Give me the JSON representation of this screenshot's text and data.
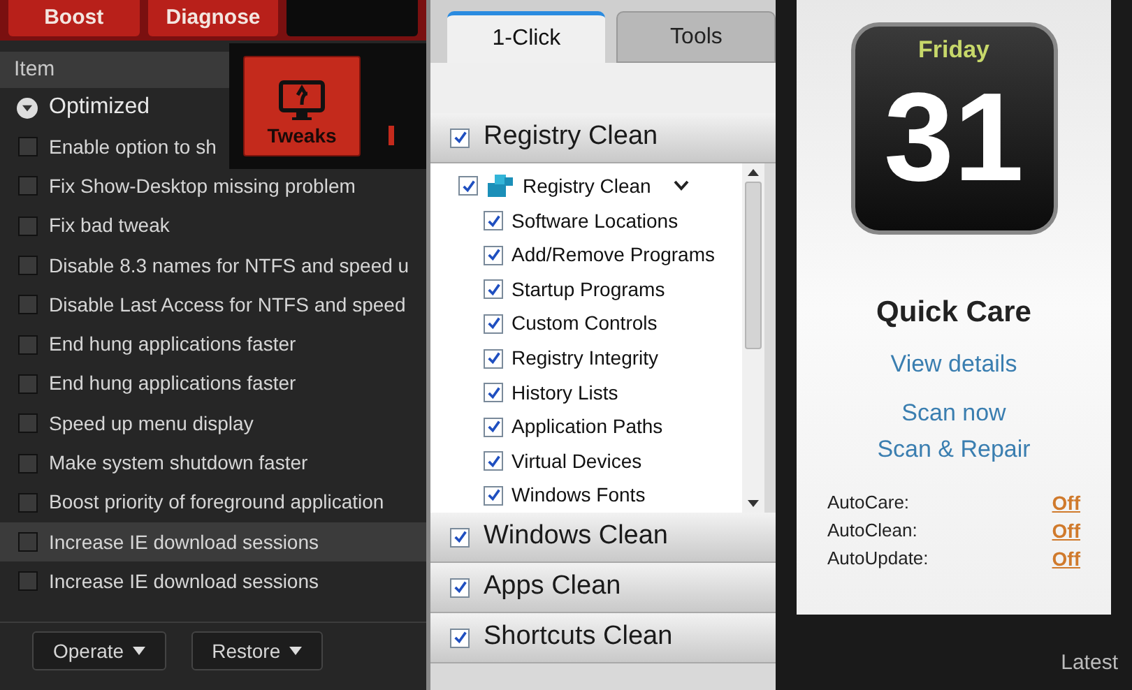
{
  "left_panel": {
    "tabs": [
      {
        "label": "Boost",
        "selected": false
      },
      {
        "label": "Diagnose",
        "selected": false
      },
      {
        "selected": true
      }
    ],
    "popup": {
      "label": "Tweaks"
    },
    "column_header": "Item",
    "group": {
      "label": "Optimized",
      "expanded": true
    },
    "items": [
      {
        "label": "Enable option to sh",
        "checked": false,
        "selected": false
      },
      {
        "label": "Fix Show-Desktop missing problem",
        "checked": false,
        "selected": false
      },
      {
        "label": "Fix bad tweak",
        "checked": false,
        "selected": false
      },
      {
        "label": "Disable 8.3 names for NTFS and speed u",
        "checked": false,
        "selected": false
      },
      {
        "label": "Disable Last Access for NTFS and speed",
        "checked": false,
        "selected": false
      },
      {
        "label": "End hung applications faster",
        "checked": false,
        "selected": false
      },
      {
        "label": "End hung applications faster",
        "checked": false,
        "selected": false
      },
      {
        "label": "Speed up menu display",
        "checked": false,
        "selected": false
      },
      {
        "label": "Make system shutdown faster",
        "checked": false,
        "selected": false
      },
      {
        "label": "Boost priority of foreground application",
        "checked": false,
        "selected": false
      },
      {
        "label": "Increase IE download sessions",
        "checked": false,
        "selected": true
      },
      {
        "label": "Increase IE download sessions",
        "checked": false,
        "selected": false
      }
    ],
    "buttons": [
      "Operate",
      "Restore"
    ]
  },
  "middle_panel": {
    "tabs": [
      {
        "label": "1-Click",
        "selected": true
      },
      {
        "label": "Tools",
        "selected": false
      }
    ],
    "sections": [
      {
        "label": "Registry Clean",
        "checked": true,
        "expanded": true,
        "tree": {
          "label": "Registry Clean",
          "checked": true,
          "children": [
            {
              "label": "Software Locations",
              "checked": true
            },
            {
              "label": "Add/Remove Programs",
              "checked": true
            },
            {
              "label": "Startup Programs",
              "checked": true
            },
            {
              "label": "Custom Controls",
              "checked": true
            },
            {
              "label": "Registry Integrity",
              "checked": true
            },
            {
              "label": "History Lists",
              "checked": true
            },
            {
              "label": "Application Paths",
              "checked": true
            },
            {
              "label": "Virtual Devices",
              "checked": true
            },
            {
              "label": "Windows Fonts",
              "checked": true
            }
          ]
        }
      },
      {
        "label": "Windows Clean",
        "checked": true,
        "expanded": false
      },
      {
        "label": "Apps Clean",
        "checked": true,
        "expanded": false
      },
      {
        "label": "Shortcuts Clean",
        "checked": true,
        "expanded": false
      }
    ]
  },
  "right_panel": {
    "calendar": {
      "weekday": "Friday",
      "day": "31"
    },
    "title": "Quick Care",
    "links": [
      "View details",
      "Scan now",
      "Scan & Repair"
    ],
    "settings": [
      {
        "label": "AutoCare:",
        "value": "Off"
      },
      {
        "label": "AutoClean:",
        "value": "Off"
      },
      {
        "label": "AutoUpdate:",
        "value": "Off"
      }
    ],
    "footer": "Latest"
  }
}
